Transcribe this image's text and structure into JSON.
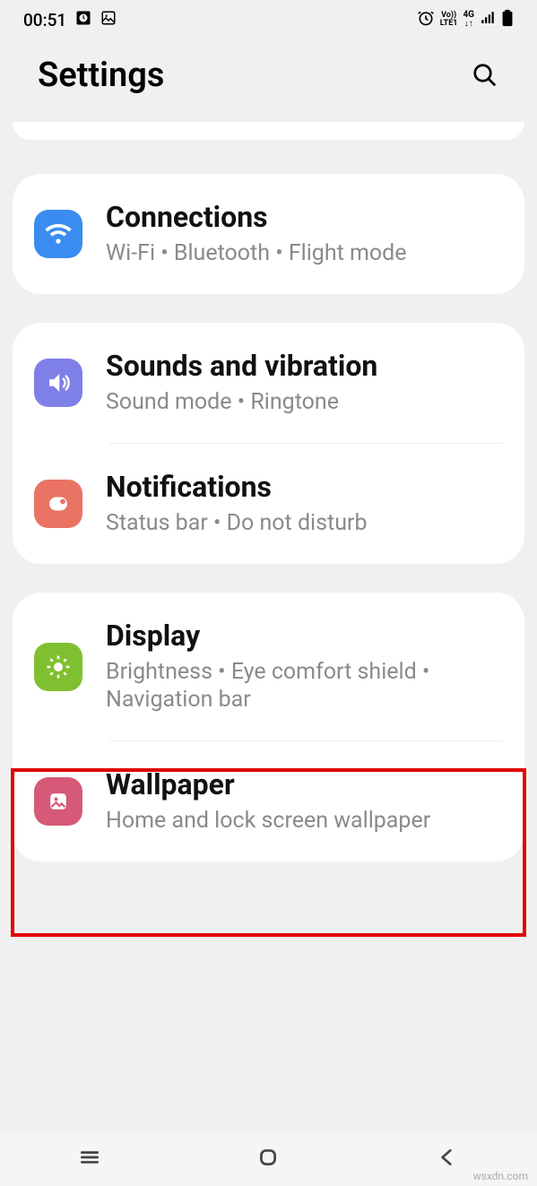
{
  "status": {
    "time": "00:51"
  },
  "header": {
    "title": "Settings"
  },
  "groups": [
    {
      "rows": [
        {
          "title": "Connections",
          "sub": "Wi-Fi  •  Bluetooth  •  Flight mode"
        }
      ]
    },
    {
      "rows": [
        {
          "title": "Sounds and vibration",
          "sub": "Sound mode  •  Ringtone"
        },
        {
          "title": "Notifications",
          "sub": "Status bar  •  Do not disturb"
        }
      ]
    },
    {
      "rows": [
        {
          "title": "Display",
          "sub": "Brightness  •  Eye comfort shield  •  Navigation bar"
        },
        {
          "title": "Wallpaper",
          "sub": "Home and lock screen wallpaper"
        }
      ]
    }
  ],
  "watermark": "wsxdn.com"
}
